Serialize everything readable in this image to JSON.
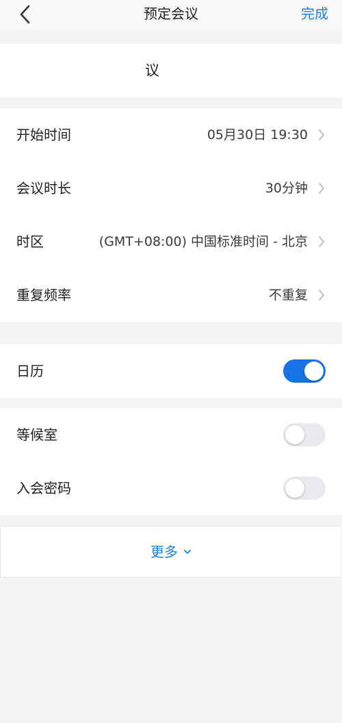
{
  "nav": {
    "title": "预定会议",
    "done_label": "完成",
    "back_icon": "chevron-left-icon"
  },
  "topic": {
    "value": "议"
  },
  "schedule": {
    "items": [
      {
        "label": "开始时间",
        "value": "05月30日 19:30"
      },
      {
        "label": "会议时长",
        "value": "30分钟"
      },
      {
        "label": "时区",
        "value": "(GMT+08:00) 中国标准时间 - 北京"
      },
      {
        "label": "重复频率",
        "value": "不重复"
      }
    ]
  },
  "calendar": {
    "label": "日历",
    "enabled": true
  },
  "security": {
    "waiting_room": {
      "label": "等候室",
      "enabled": false
    },
    "password": {
      "label": "入会密码",
      "enabled": false
    }
  },
  "more": {
    "label": "更多"
  },
  "colors": {
    "accent": "#1f7fe0",
    "toggle_on": "#1673e6",
    "toggle_off": "#e9eaed",
    "background": "#f4f5f7"
  }
}
